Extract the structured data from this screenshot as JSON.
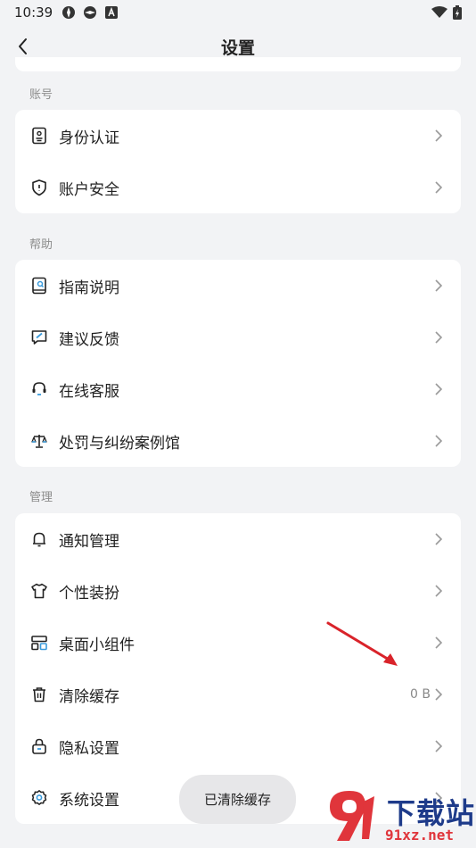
{
  "status_bar": {
    "time": "10:39"
  },
  "nav": {
    "title": "设置"
  },
  "sections": [
    {
      "label": "账号",
      "rows": [
        {
          "label": "身份认证",
          "icon": "id-card-icon"
        },
        {
          "label": "账户安全",
          "icon": "shield-icon"
        }
      ]
    },
    {
      "label": "帮助",
      "rows": [
        {
          "label": "指南说明",
          "icon": "guide-book-icon"
        },
        {
          "label": "建议反馈",
          "icon": "feedback-icon"
        },
        {
          "label": "在线客服",
          "icon": "headset-icon"
        },
        {
          "label": "处罚与纠纷案例馆",
          "icon": "scales-icon"
        }
      ]
    },
    {
      "label": "管理",
      "rows": [
        {
          "label": "通知管理",
          "icon": "bell-icon"
        },
        {
          "label": "个性装扮",
          "icon": "shirt-icon"
        },
        {
          "label": "桌面小组件",
          "icon": "widgets-icon"
        },
        {
          "label": "清除缓存",
          "icon": "trash-icon",
          "value": "0 B"
        },
        {
          "label": "隐私设置",
          "icon": "lock-icon"
        },
        {
          "label": "系统设置",
          "icon": "gear-icon"
        }
      ]
    }
  ],
  "toast": {
    "text": "已清除缓存"
  },
  "watermark": {
    "top": "下载站",
    "bottom": "91xz.net"
  },
  "colors": {
    "accent": "#3a9bdc",
    "annotation_arrow": "#d9232a"
  }
}
